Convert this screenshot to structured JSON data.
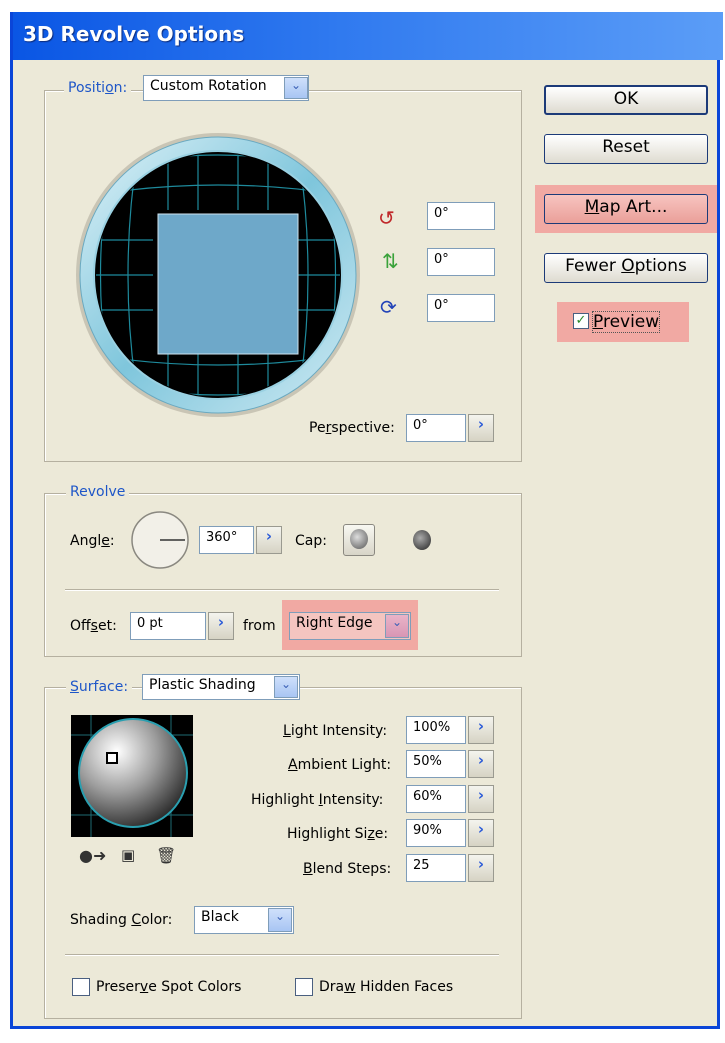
{
  "title": "3D Revolve Options",
  "position": {
    "legend_prefix": "Positi",
    "legend_underlined": "o",
    "legend_suffix": "n:",
    "select_value": "Custom Rotation",
    "rot_x": "0°",
    "rot_y": "0°",
    "rot_z": "0°",
    "perspective_prefix": "Pe",
    "perspective_underlined": "r",
    "perspective_suffix": "spective:",
    "perspective_value": "0°"
  },
  "revolve": {
    "legend": "Revolve",
    "angle_prefix": "Angl",
    "angle_underlined": "e",
    "angle_suffix": ":",
    "angle_value": "360°",
    "cap_label": "Cap:",
    "offset_prefix": "Off",
    "offset_underlined": "s",
    "offset_suffix": "et:",
    "offset_value": "0 pt",
    "from_label": "from",
    "from_value": "Right Edge"
  },
  "surface": {
    "legend_underlined": "S",
    "legend_suffix": "urface:",
    "select_value": "Plastic Shading",
    "light_intensity": {
      "pre": "",
      "u": "L",
      "post": "ight Intensity:",
      "value": "100%"
    },
    "ambient_light": {
      "pre": "",
      "u": "A",
      "post": "mbient Light:",
      "value": "50%"
    },
    "highlight_intensity": {
      "pre": "Highlight ",
      "u": "I",
      "post": "ntensity:",
      "value": "60%"
    },
    "highlight_size": {
      "pre": "Highlight Si",
      "u": "z",
      "post": "e:",
      "value": "90%"
    },
    "blend_steps": {
      "pre": "",
      "u": "B",
      "post": "lend Steps:",
      "value": "25"
    },
    "shading_color_pre": "Shading ",
    "shading_color_u": "C",
    "shading_color_post": "olor:",
    "shading_color_value": "Black",
    "preserve_pre": "Preser",
    "preserve_u": "v",
    "preserve_post": "e Spot Colors",
    "hidden_pre": "Dra",
    "hidden_u": "w",
    "hidden_post": " Hidden Faces"
  },
  "buttons": {
    "ok": "OK",
    "reset": "Reset",
    "map_art_u": "M",
    "map_art_post": "ap Art...",
    "fewer_pre": "Fewer ",
    "fewer_u": "O",
    "fewer_post": "ptions",
    "preview_u": "P",
    "preview_post": "review"
  },
  "colors": {
    "highlight": "#f1a9a3",
    "title_bar": "#0a56e4",
    "legend_text": "#1e56c8"
  }
}
